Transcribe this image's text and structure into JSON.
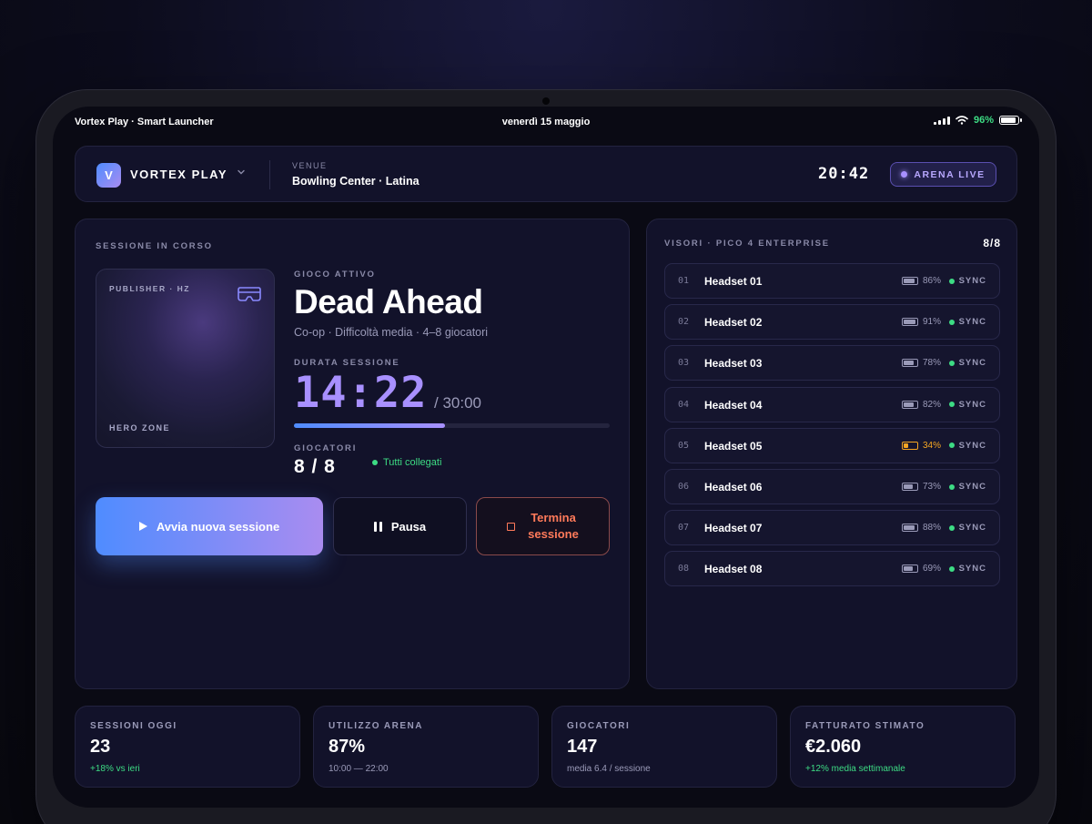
{
  "status_bar": {
    "app_title": "Vortex Play · Smart Launcher",
    "date": "venerdì 15 maggio",
    "battery": "96%"
  },
  "header": {
    "brand_initial": "V",
    "brand_name": "VORTEX PLAY",
    "venue_label": "VENUE",
    "venue_value": "Bowling Center · Latina",
    "clock": "20:42",
    "live_badge": "ARENA LIVE"
  },
  "session": {
    "section_label": "SESSIONE IN CORSO",
    "card": {
      "publisher": "PUBLISHER · HZ",
      "zone": "HERO ZONE",
      "icon": "vr-headset-icon"
    },
    "active_game_label": "GIOCO ATTIVO",
    "game_title": "Dead Ahead",
    "game_meta": "Co-op · Difficoltà media · 4–8 giocatori",
    "duration_label": "DURATA SESSIONE",
    "timer": "14:22",
    "timer_total": "/ 30:00",
    "progress_fraction": 0.479,
    "players_label": "GIOCATORI",
    "players_value": "8 / 8",
    "players_status": "Tutti collegati",
    "buttons": {
      "start": "Avvia nuova sessione",
      "pause": "Pausa",
      "end_line1": "Termina",
      "end_line2": "sessione"
    }
  },
  "headsets": {
    "section_label": "VISORI · PICO 4 ENTERPRISE",
    "count": "8/8",
    "sync_label": "SYNC",
    "items": [
      {
        "num": "01",
        "name": "Headset 01",
        "battery": "86%",
        "level": 0.86,
        "low": false
      },
      {
        "num": "02",
        "name": "Headset 02",
        "battery": "91%",
        "level": 0.91,
        "low": false
      },
      {
        "num": "03",
        "name": "Headset 03",
        "battery": "78%",
        "level": 0.78,
        "low": false
      },
      {
        "num": "04",
        "name": "Headset 04",
        "battery": "82%",
        "level": 0.82,
        "low": false
      },
      {
        "num": "05",
        "name": "Headset 05",
        "battery": "34%",
        "level": 0.34,
        "low": true
      },
      {
        "num": "06",
        "name": "Headset 06",
        "battery": "73%",
        "level": 0.73,
        "low": false
      },
      {
        "num": "07",
        "name": "Headset 07",
        "battery": "88%",
        "level": 0.88,
        "low": false
      },
      {
        "num": "08",
        "name": "Headset 08",
        "battery": "69%",
        "level": 0.69,
        "low": false
      }
    ]
  },
  "stats": [
    {
      "label": "SESSIONI OGGI",
      "value": "23",
      "sub": "+18% vs ieri",
      "positive": true
    },
    {
      "label": "UTILIZZO ARENA",
      "value": "87%",
      "sub": "10:00 — 22:00",
      "positive": false
    },
    {
      "label": "GIOCATORI",
      "value": "147",
      "sub": "media 6.4 / sessione",
      "positive": false
    },
    {
      "label": "FATTURATO STIMATO",
      "value": "€2.060",
      "sub": "+12% media settimanale",
      "positive": true
    }
  ],
  "colors": {
    "accent": "#a890ff",
    "accent_blue": "#4f8cff",
    "success": "#3ddc84",
    "warning": "#f5a623",
    "danger": "#ff7a5a"
  }
}
